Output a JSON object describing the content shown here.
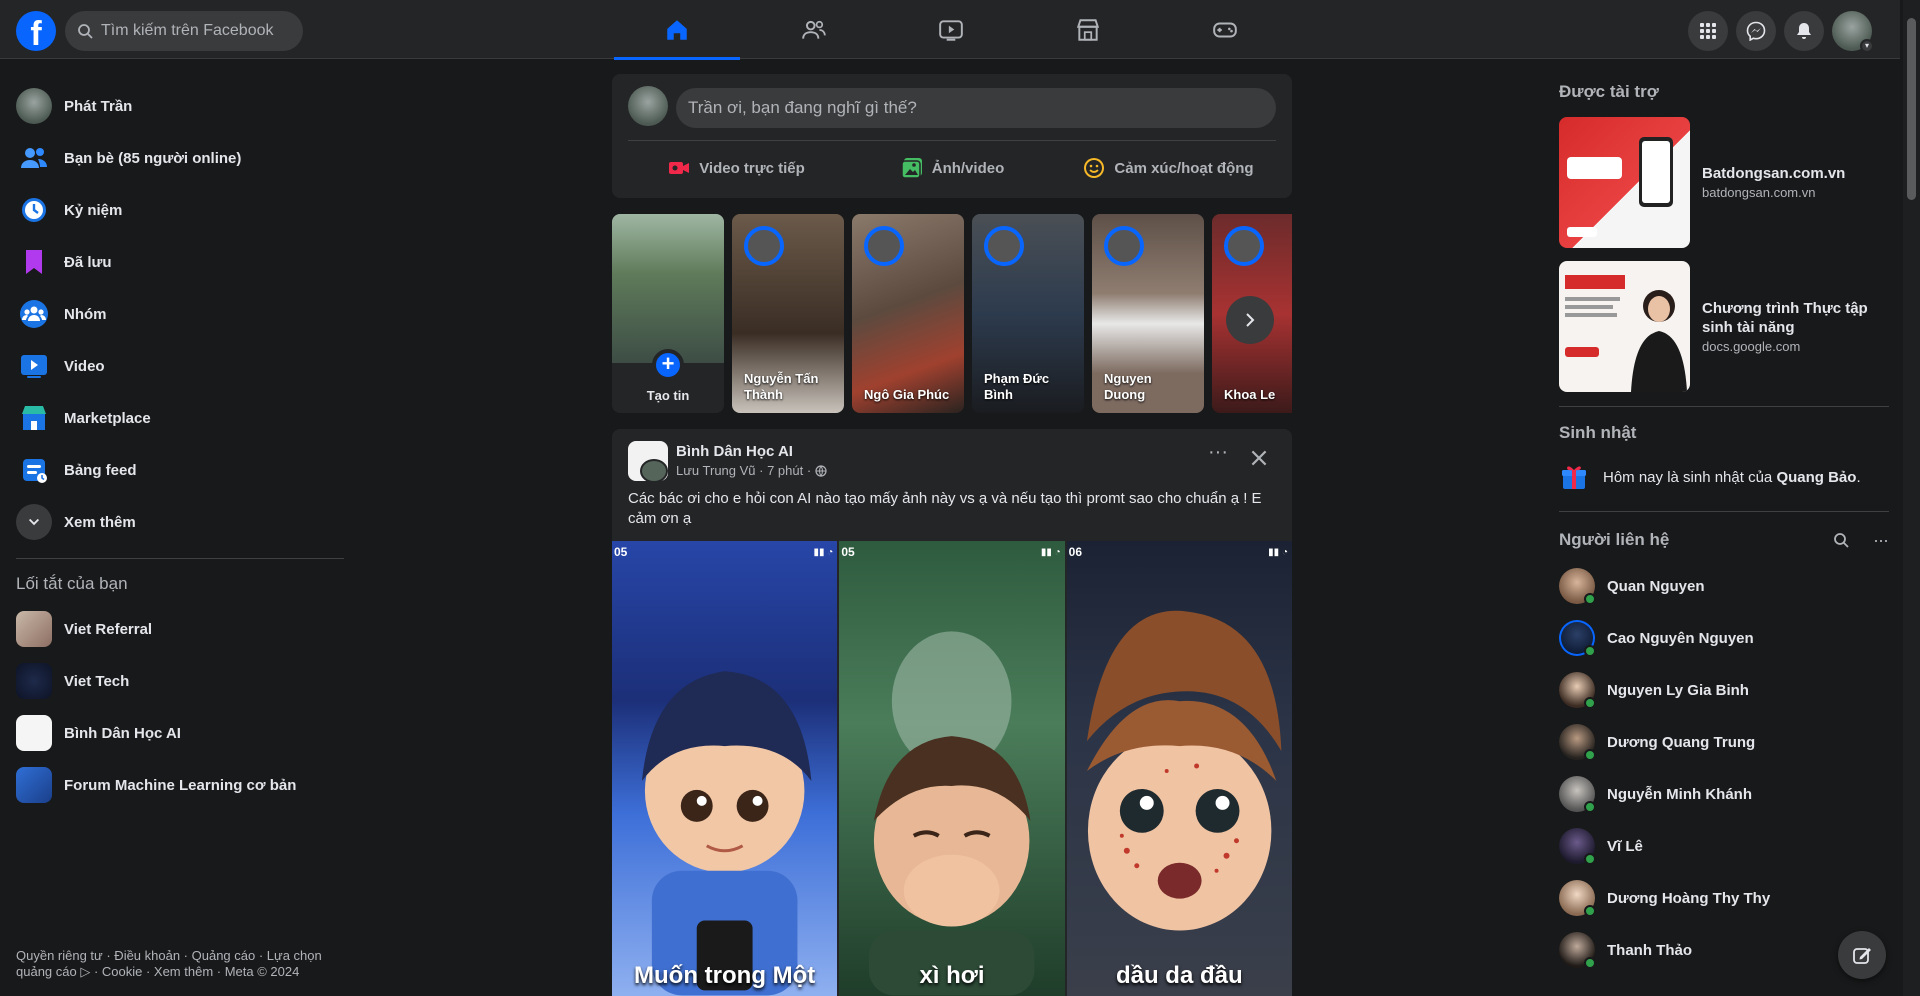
{
  "topbar": {
    "logo": "f",
    "search_placeholder": "Tìm kiếm trên Facebook",
    "nav": [
      {
        "name": "home-icon",
        "active": true
      },
      {
        "name": "friends-icon",
        "active": false
      },
      {
        "name": "video-icon",
        "active": false
      },
      {
        "name": "marketplace-icon",
        "active": false
      },
      {
        "name": "gaming-icon",
        "active": false
      }
    ],
    "right_buttons": [
      "menu-grid-icon",
      "messenger-icon",
      "notifications-bell-icon"
    ],
    "accent_color": "#0866ff"
  },
  "sidebar": {
    "items": [
      {
        "label": "Phát Trần",
        "icon": "profile-avatar"
      },
      {
        "label": "Bạn bè (85 người online)",
        "icon": "friends-icon"
      },
      {
        "label": "Kỷ niệm",
        "icon": "memories-clock-icon"
      },
      {
        "label": "Đã lưu",
        "icon": "saved-bookmark-icon"
      },
      {
        "label": "Nhóm",
        "icon": "groups-icon"
      },
      {
        "label": "Video",
        "icon": "video-icon"
      },
      {
        "label": "Marketplace",
        "icon": "marketplace-icon"
      },
      {
        "label": "Bảng feed",
        "icon": "feeds-icon"
      },
      {
        "label": "Xem thêm",
        "icon": "chevron-down-icon"
      }
    ],
    "shortcuts_title": "Lối tắt của bạn",
    "shortcuts": [
      {
        "label": "Viet Referral"
      },
      {
        "label": "Viet Tech"
      },
      {
        "label": "Bình Dân Học AI"
      },
      {
        "label": "Forum Machine Learning cơ bản"
      }
    ],
    "footer": "Quyền riêng tư · Điều khoản · Quảng cáo · Lựa chọn quảng cáo ▷ · Cookie · Xem thêm · Meta © 2024"
  },
  "composer": {
    "placeholder": "Trần ơi, bạn đang nghĩ gì thế?",
    "actions": [
      {
        "label": "Video trực tiếp",
        "icon": "live-video-icon",
        "color": "#f02849"
      },
      {
        "label": "Ảnh/video",
        "icon": "photo-icon",
        "color": "#45bd62"
      },
      {
        "label": "Cảm xúc/hoạt động",
        "icon": "feeling-smile-icon",
        "color": "#f7b928"
      }
    ]
  },
  "stories": {
    "create_label": "Tạo tin",
    "items": [
      {
        "name": "Nguyễn Tấn Thành"
      },
      {
        "name": "Ngô Gia Phúc"
      },
      {
        "name": "Phạm Đức Bình"
      },
      {
        "name": "Nguyen Duong"
      },
      {
        "name": "Khoa Le"
      }
    ]
  },
  "post": {
    "author": "Bình Dân Học AI",
    "meta": "Lưu Trung Vũ · 7 phút ·",
    "text": "Các bác ơi cho e hỏi con AI nào tạo mấy ảnh này vs ạ và nếu tạo thì promt sao cho chuẩn ạ ! E cảm ơn ạ",
    "images": [
      {
        "time": "05",
        "caption": "Muốn trong Một"
      },
      {
        "time": "05",
        "caption": "xì hơi"
      },
      {
        "time": "06",
        "caption": "dầu da đầu"
      }
    ]
  },
  "right": {
    "sponsored_title": "Được tài trợ",
    "ads": [
      {
        "name": "Batdongsan.com.vn",
        "domain": "batdongsan.com.vn"
      },
      {
        "name": "Chương trình Thực tập sinh tài năng",
        "domain": "docs.google.com"
      }
    ],
    "birthday_title": "Sinh nhật",
    "birthday_text_prefix": "Hôm nay là sinh nhật của ",
    "birthday_name": "Quang Bảo",
    "birthday_suffix": ".",
    "contacts_title": "Người liên hệ",
    "contacts": [
      {
        "name": "Quan Nguyen"
      },
      {
        "name": "Cao Nguyên Nguyen"
      },
      {
        "name": "Nguyen Ly Gia Binh"
      },
      {
        "name": "Dương Quang Trung"
      },
      {
        "name": "Nguyễn Minh Khánh"
      },
      {
        "name": "Vĩ Lê"
      },
      {
        "name": "Dương Hoàng Thy Thy"
      },
      {
        "name": "Thanh Thảo"
      }
    ]
  }
}
